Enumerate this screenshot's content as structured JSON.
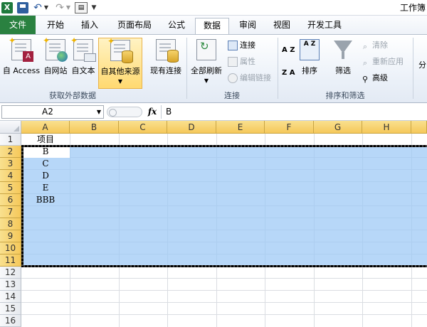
{
  "window": {
    "title": "工作簿"
  },
  "quick_access": {
    "app_icon": "X"
  },
  "tabs": {
    "file": "文件",
    "home": "开始",
    "insert": "插入",
    "page_layout": "页面布局",
    "formulas": "公式",
    "data": "数据",
    "review": "审阅",
    "view": "视图",
    "developer": "开发工具"
  },
  "ribbon": {
    "external_data": {
      "access": "自 Access",
      "web": "自网站",
      "text": "自文本",
      "other_sources": "自其他来源",
      "existing": "现有连接",
      "label": "获取外部数据"
    },
    "connections": {
      "refresh_all": "全部刷新",
      "connections": "连接",
      "properties": "属性",
      "edit_links": "编辑链接",
      "label": "连接"
    },
    "sort_filter": {
      "sort_asc": "A Z",
      "sort_desc": "Z A",
      "sort_icon_az": "A Z",
      "sort_icon_za": "Z A",
      "sort": "排序",
      "filter": "筛选",
      "clear": "清除",
      "reapply": "重新应用",
      "advanced": "高级",
      "label": "排序和筛选"
    },
    "more": "分"
  },
  "formula_bar": {
    "name_box": "A2",
    "fx": "fx",
    "value": "B"
  },
  "columns": [
    "A",
    "B",
    "C",
    "D",
    "E",
    "F",
    "G",
    "H"
  ],
  "rows": [
    "1",
    "2",
    "3",
    "4",
    "5",
    "6",
    "7",
    "8",
    "9",
    "10",
    "11",
    "12",
    "13",
    "14",
    "15",
    "16"
  ],
  "cells": {
    "a1": "项目",
    "a2": "B",
    "a3": "C",
    "a4": "D",
    "a5": "E",
    "a6": "BBB"
  },
  "colors": {
    "file_tab": "#2a8140",
    "selection": "#9bc8f5",
    "header_selected": "#f5c85a"
  }
}
